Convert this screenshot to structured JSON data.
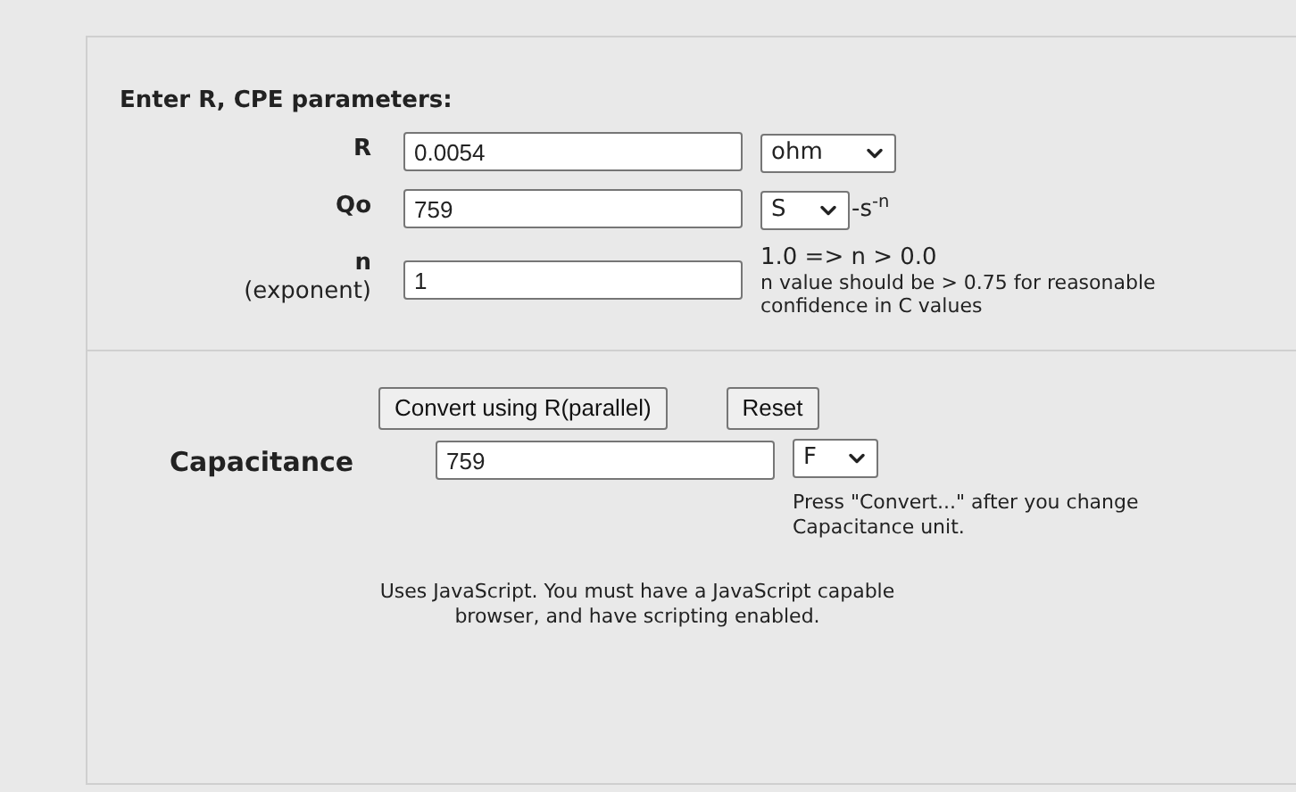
{
  "heading": "Enter R, CPE parameters:",
  "params": [
    {
      "label": "R",
      "value": "0.0054",
      "unit": "ohm"
    },
    {
      "label": "Qo",
      "value": "759",
      "unit": "S",
      "suffix": "-s$^{-n}$"
    },
    {
      "label": "n",
      "sublabel": "(exponent)",
      "value": "1",
      "range": "1.0 => n > 0.0",
      "note": "n value should be > 0.75 for reasonable confidence in C values"
    }
  ],
  "buttons": [
    {
      "label": "Convert using R(parallel)"
    },
    {
      "label": "Reset"
    }
  ],
  "result": {
    "label": "Capacitance",
    "value": "759",
    "unit": "F",
    "note": "Press \"Convert...\" after you change Capacitance unit."
  },
  "footer": "Uses JavaScript. You must have a JavaScript capable browser, and have scripting enabled."
}
